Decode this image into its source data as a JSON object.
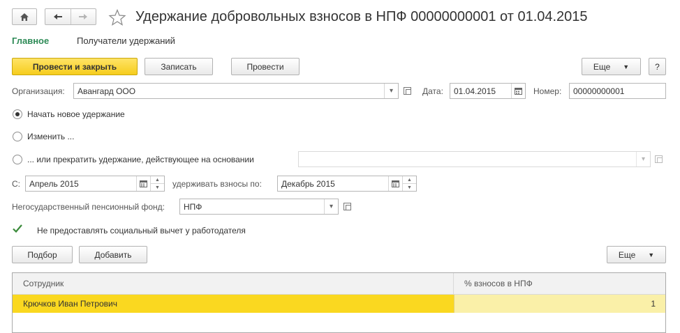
{
  "window": {
    "title": "Удержание добровольных взносов в НПФ 00000000001 от 01.04.2015"
  },
  "tabs": {
    "main": "Главное",
    "recipients": "Получатели удержаний"
  },
  "toolbar": {
    "post_and_close": "Провести и закрыть",
    "save": "Записать",
    "post": "Провести",
    "more": "Еще",
    "help": "?"
  },
  "header": {
    "organization_label": "Организация:",
    "organization_value": "Авангард ООО",
    "date_label": "Дата:",
    "date_value": "01.04.2015",
    "number_label": "Номер:",
    "number_value": "00000000001"
  },
  "options": {
    "start_new": "Начать новое удержание",
    "change": "Изменить ...",
    "stop": "... или прекратить удержание, действующее на основании",
    "selected": "start_new"
  },
  "period": {
    "from_label": "С:",
    "from_value": "Апрель 2015",
    "to_label": "удерживать взносы по:",
    "to_value": "Декабрь 2015"
  },
  "fund": {
    "label": "Негосударственный пенсионный фонд:",
    "value": "НПФ"
  },
  "deduction": {
    "label": "Не предоставлять социальный вычет у работодателя",
    "checked": true
  },
  "table_toolbar": {
    "select": "Подбор",
    "add": "Добавить",
    "more": "Еще"
  },
  "table": {
    "columns": [
      "Сотрудник",
      "% взносов в НПФ"
    ],
    "rows": [
      {
        "employee": "Крючков Иван Петрович",
        "percent": "1"
      }
    ]
  }
}
